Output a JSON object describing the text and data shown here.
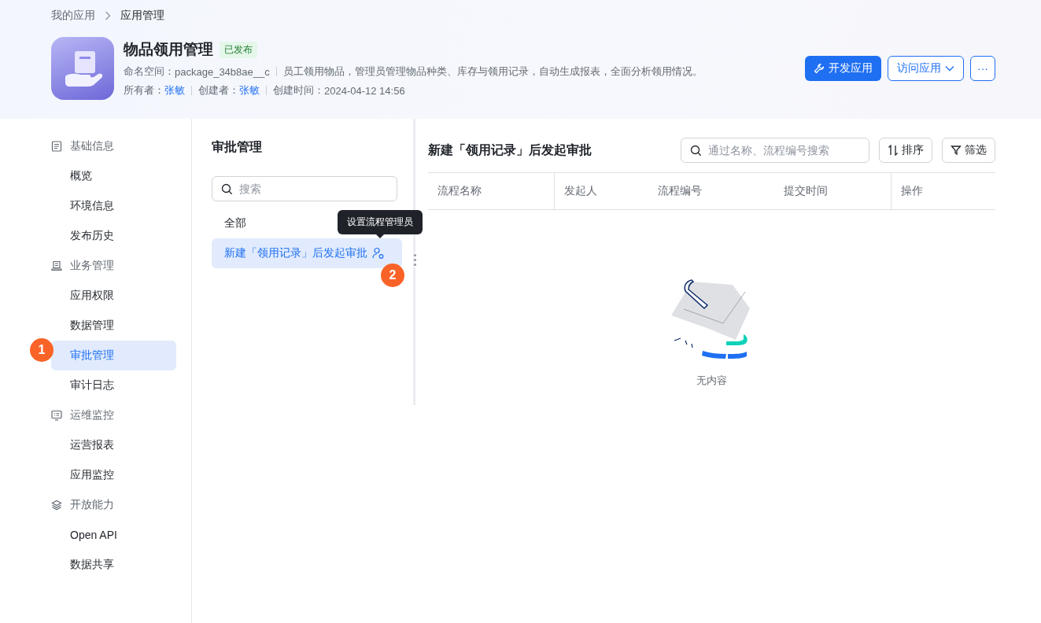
{
  "breadcrumb": [
    "我的应用",
    "应用管理"
  ],
  "app": {
    "name": "物品领用管理",
    "status": "已发布",
    "namespace_label": "命名空间：",
    "namespace": "package_34b8ae__c",
    "description": "员工领用物品，管理员管理物品种类、库存与领用记录，自动生成报表，全面分析领用情况。",
    "owner_label": "所有者：",
    "owner": "张敏",
    "creator_label": "创建者：",
    "creator": "张敏",
    "created_label": "创建时间：",
    "created": "2024-04-12 14:56"
  },
  "actions": [
    {
      "kind": "primary",
      "label": "开发应用"
    },
    {
      "kind": "dropdown",
      "label": "访问应用"
    },
    {
      "kind": "more",
      "label": "···"
    }
  ],
  "sidebar": [
    {
      "title": "基础信息",
      "kind": "document",
      "items": [
        {
          "label": "概览",
          "selected": false
        },
        {
          "label": "环境信息",
          "selected": false
        },
        {
          "label": "发布历史",
          "selected": false
        }
      ]
    },
    {
      "title": "业务管理",
      "kind": "book",
      "items": [
        {
          "label": "应用权限",
          "selected": false
        },
        {
          "label": "数据管理",
          "selected": false
        },
        {
          "label": "审批管理",
          "selected": true,
          "marker": "1"
        },
        {
          "label": "审计日志",
          "selected": false
        }
      ]
    },
    {
      "title": "运维监控",
      "kind": "monitor",
      "items": [
        {
          "label": "运营报表",
          "selected": false
        },
        {
          "label": "应用监控",
          "selected": false
        }
      ]
    },
    {
      "title": "开放能力",
      "kind": "layers",
      "items": [
        {
          "label": "Open API",
          "selected": false
        },
        {
          "label": "数据共享",
          "selected": false
        }
      ]
    }
  ],
  "flows": {
    "title": "审批管理",
    "search": {
      "placeholder": "搜索"
    },
    "items": [
      {
        "label": "全部",
        "selected": false
      },
      {
        "label": "新建「领用记录」后发起审批",
        "selected": true,
        "tooltip": "设置流程管理员",
        "marker": "2"
      }
    ]
  },
  "detail": {
    "title": "新建「领用记录」后发起审批",
    "search": {
      "placeholder": "通过名称、流程编号搜索"
    },
    "tools": [
      {
        "kind": "sort",
        "label": "排序"
      },
      {
        "kind": "filter",
        "label": "筛选"
      }
    ],
    "columns": [
      "流程名称",
      "发起人",
      "流程编号",
      "提交时间",
      "操作"
    ],
    "empty": "无内容"
  }
}
